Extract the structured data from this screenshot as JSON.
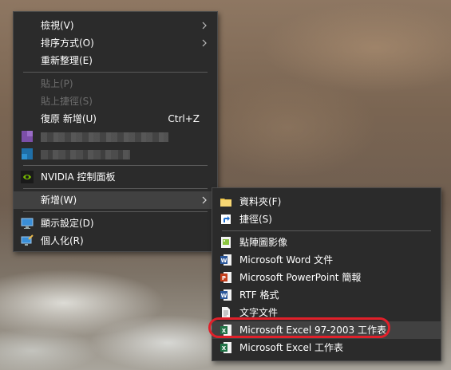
{
  "context_menu": {
    "items": [
      {
        "label": "檢視(V)",
        "submenu": true
      },
      {
        "label": "排序方式(O)",
        "submenu": true
      },
      {
        "label": "重新整理(E)"
      },
      {
        "label": "貼上(P)",
        "disabled": true
      },
      {
        "label": "貼上捷徑(S)",
        "disabled": true
      },
      {
        "label": "復原 新增(U)",
        "shortcut": "Ctrl+Z"
      },
      {
        "label": "NVIDIA 控制面板",
        "icon": "nvidia-icon"
      },
      {
        "label": "新增(W)",
        "submenu": true
      },
      {
        "label": "顯示設定(D)",
        "icon": "display-icon"
      },
      {
        "label": "個人化(R)",
        "icon": "personalize-icon"
      }
    ]
  },
  "new_submenu": {
    "items": [
      {
        "label": "資料夾(F)",
        "icon": "folder-icon"
      },
      {
        "label": "捷徑(S)",
        "icon": "shortcut-icon"
      },
      {
        "label": "點陣圖影像",
        "icon": "bitmap-icon"
      },
      {
        "label": "Microsoft Word 文件",
        "icon": "word-icon"
      },
      {
        "label": "Microsoft PowerPoint 簡報",
        "icon": "powerpoint-icon"
      },
      {
        "label": "RTF 格式",
        "icon": "rtf-icon"
      },
      {
        "label": "文字文件",
        "icon": "text-document-icon"
      },
      {
        "label": "Microsoft Excel 97-2003 工作表",
        "icon": "excel-icon",
        "highlighted": true
      },
      {
        "label": "Microsoft Excel 工作表",
        "icon": "excel-icon"
      }
    ]
  },
  "colors": {
    "menu_bg": "#2b2b2b",
    "hover_bg": "#414141",
    "annotation_ring": "#e0202a"
  }
}
